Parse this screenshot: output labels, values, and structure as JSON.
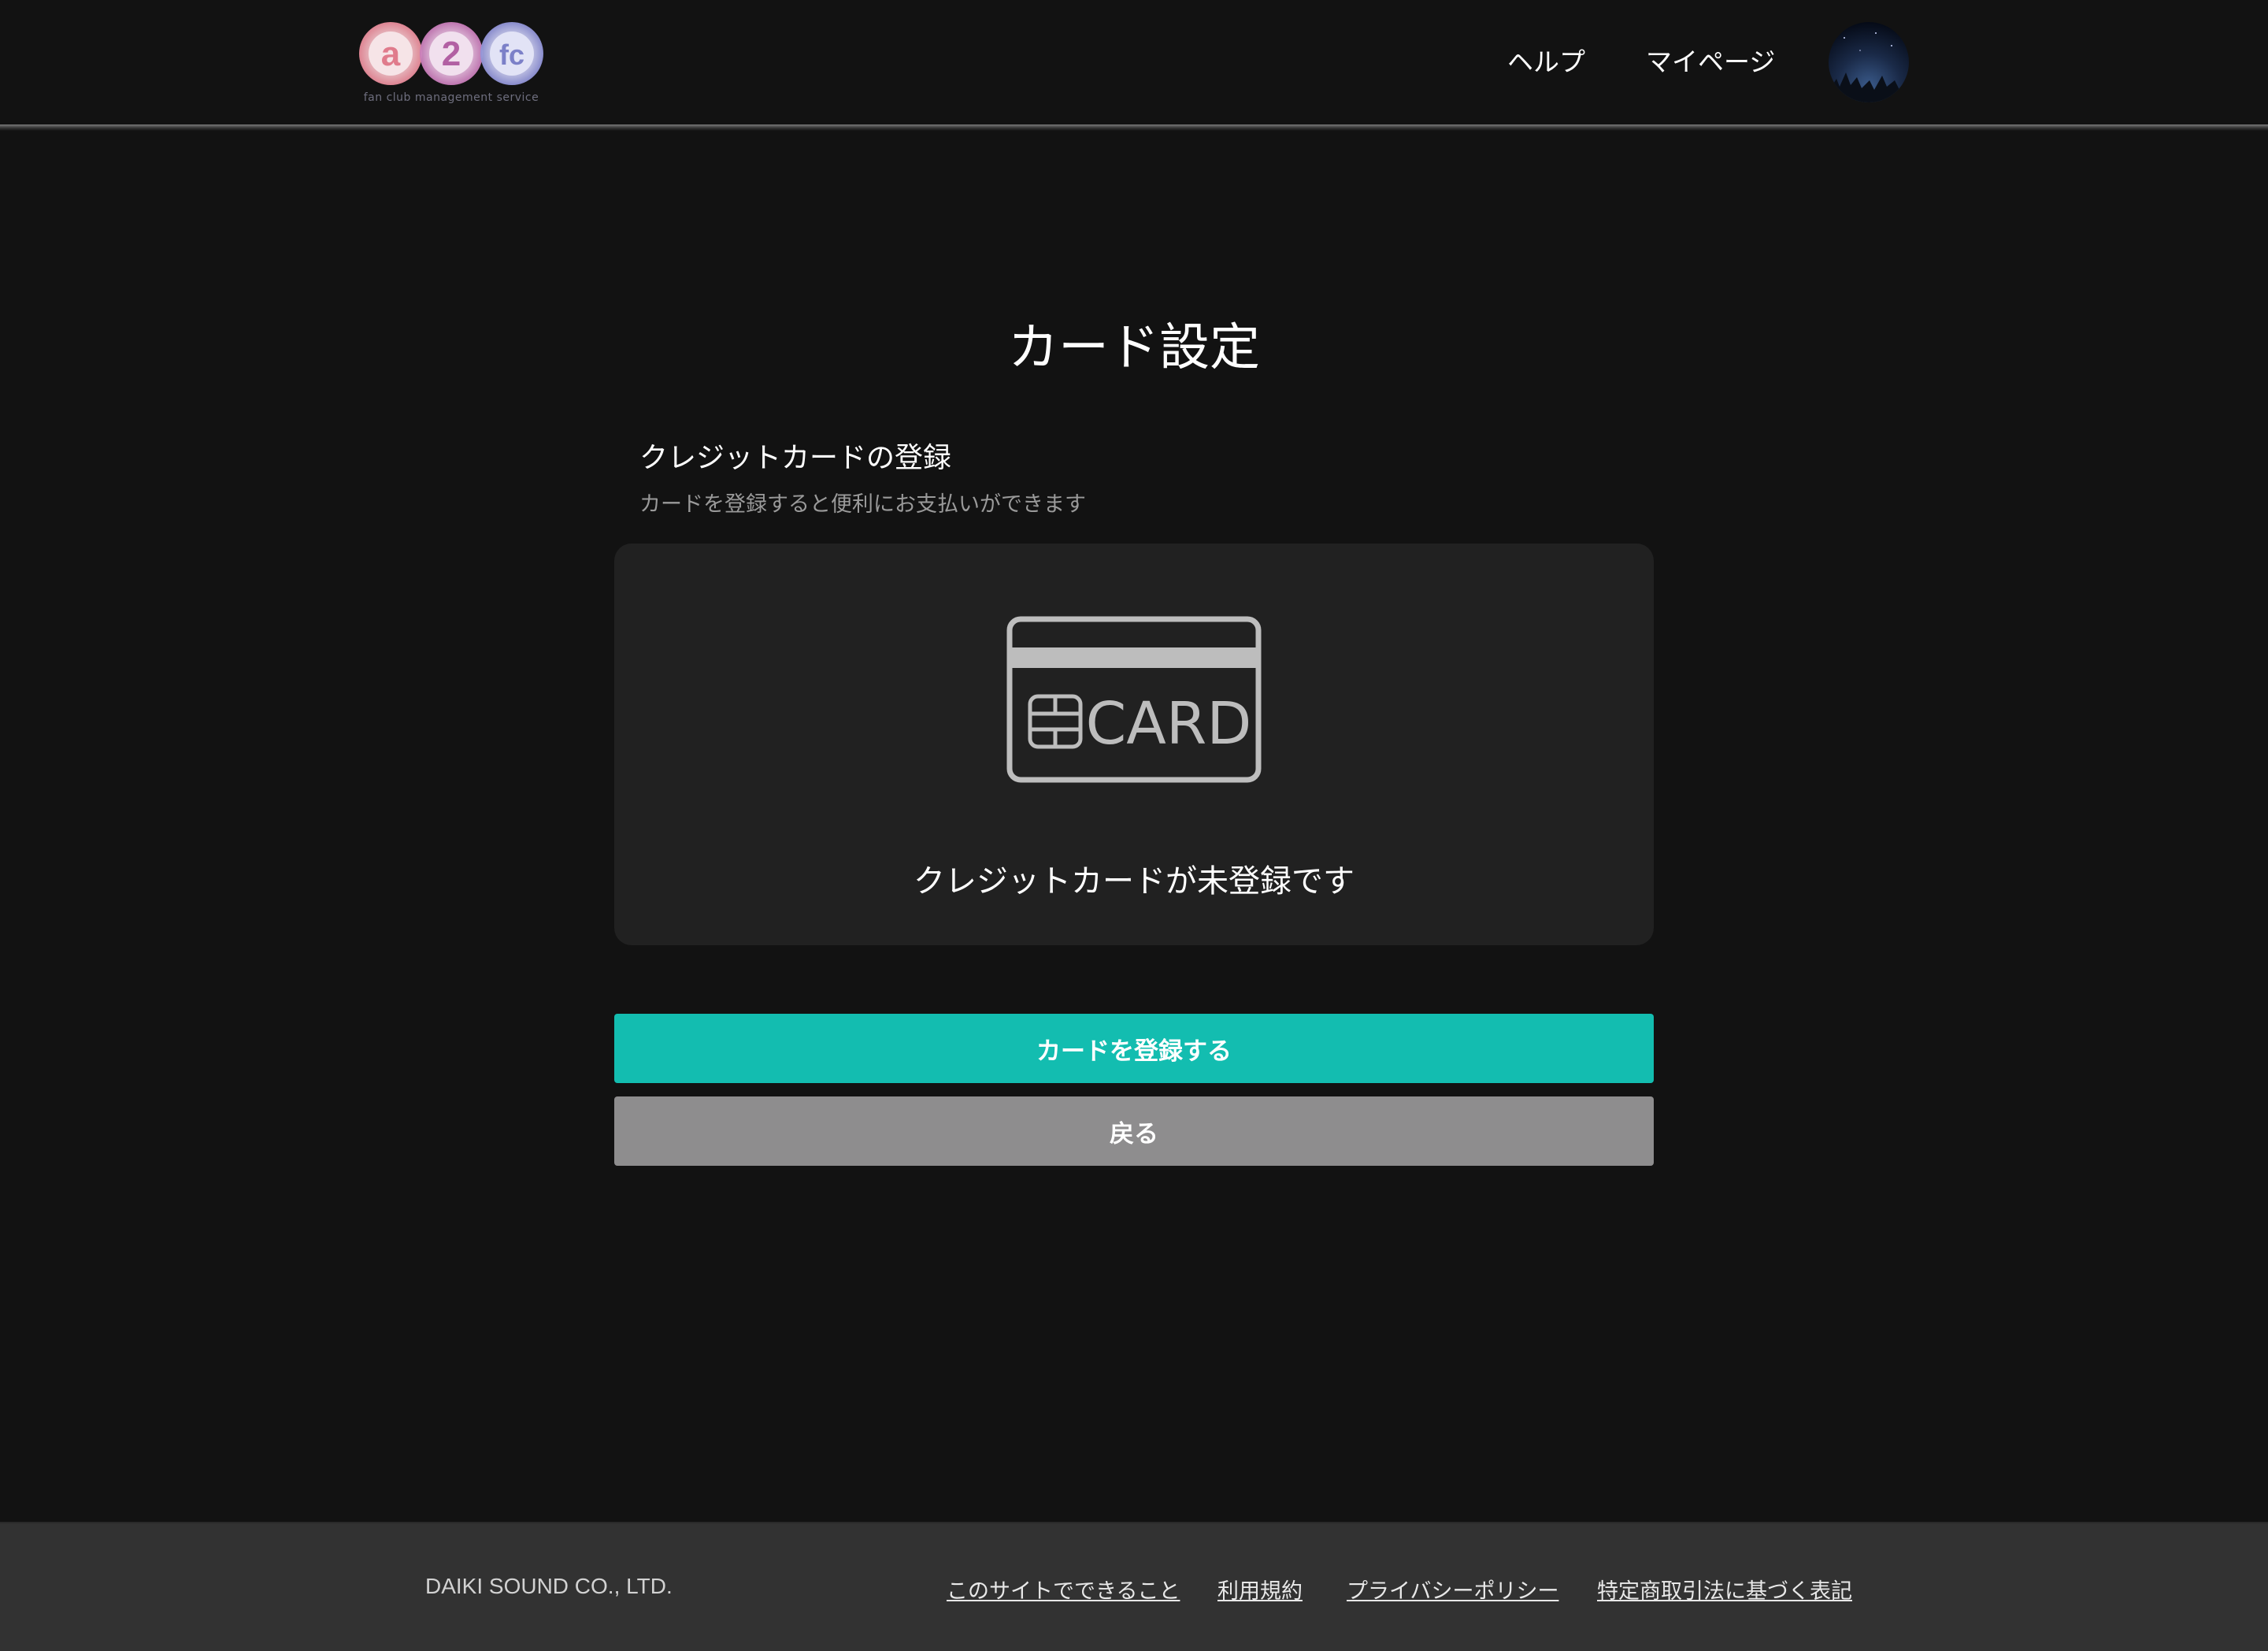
{
  "header": {
    "logo_text": "a2fc",
    "logo_sub": "fan club management service",
    "nav": {
      "help": "ヘルプ",
      "mypage": "マイページ"
    }
  },
  "main": {
    "title": "カード設定",
    "section_title": "クレジットカードの登録",
    "section_desc": "カードを登録すると便利にお支払いができます",
    "card_icon_text": "CARD",
    "card_status": "クレジットカードが未登録です",
    "register_button": "カードを登録する",
    "back_button": "戻る"
  },
  "footer": {
    "company": "DAIKI SOUND CO., LTD.",
    "links": [
      "このサイトでできること",
      "利用規約",
      "プライバシーポリシー",
      "特定商取引法に基づく表記"
    ]
  },
  "colors": {
    "background": "#121212",
    "panel": "#212121",
    "accent": "#13bdb0",
    "back_button": "#8e8d8e",
    "footer": "#323232"
  }
}
